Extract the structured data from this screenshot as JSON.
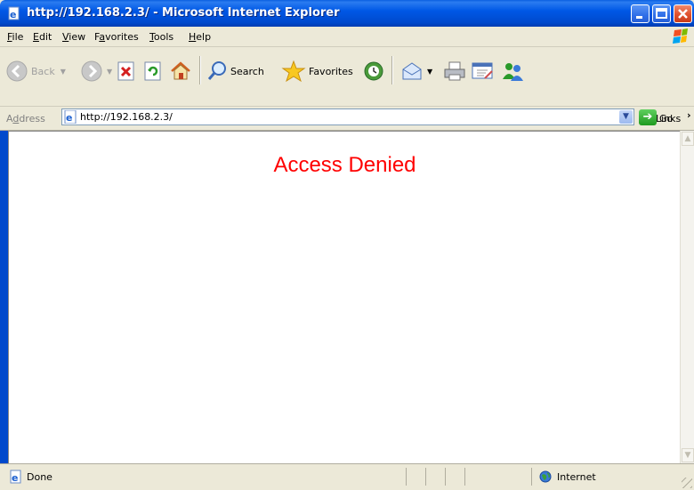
{
  "window": {
    "title": "http://192.168.2.3/ - Microsoft Internet Explorer"
  },
  "menu": {
    "items": [
      {
        "pre": "",
        "key": "F",
        "post": "ile"
      },
      {
        "pre": "",
        "key": "E",
        "post": "dit"
      },
      {
        "pre": "",
        "key": "V",
        "post": "iew"
      },
      {
        "pre": "F",
        "key": "a",
        "post": "vorites"
      },
      {
        "pre": "",
        "key": "T",
        "post": "ools"
      },
      {
        "pre": "",
        "key": "H",
        "post": "elp"
      }
    ]
  },
  "toolbar": {
    "back_label": "Back",
    "search_label": "Search",
    "favorites_label": "Favorites"
  },
  "address": {
    "label": "Address",
    "label_key": "d",
    "value": "http://192.168.2.3/",
    "go_label": "Go",
    "links_label": "Links"
  },
  "page": {
    "heading": "Access Denied",
    "heading_color": "#ff0000"
  },
  "status": {
    "text": "Done",
    "zone": "Internet"
  }
}
